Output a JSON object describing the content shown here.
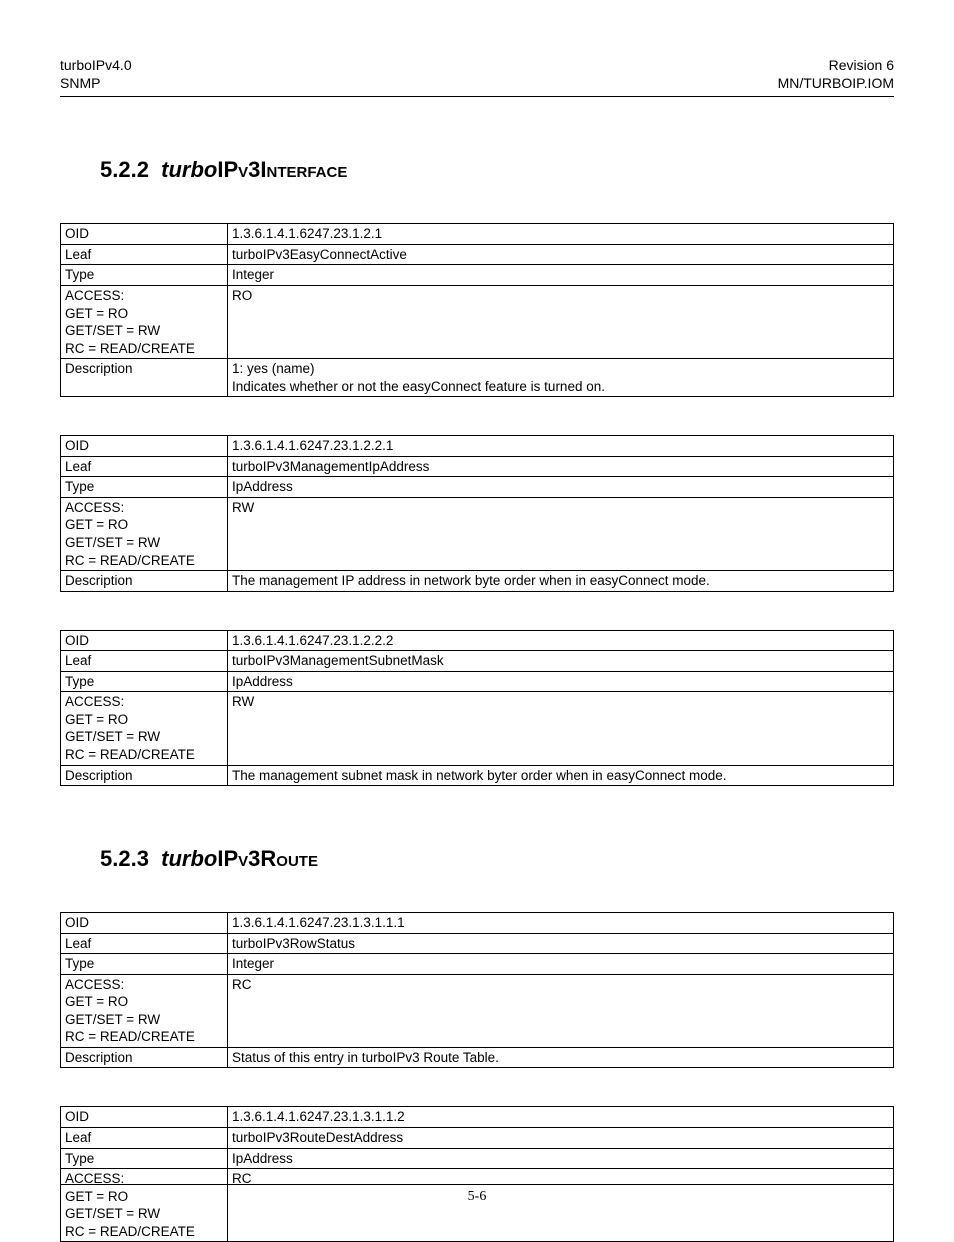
{
  "header": {
    "left_line1": "turboIPv4.0",
    "left_line2": "SNMP",
    "right_line1": "Revision 6",
    "right_line2": "MN/TURBOIP.IOM"
  },
  "sections": [
    {
      "number": "5.2.2",
      "title_prefix": "turbo",
      "title_rest": "IPv3Interface",
      "tables": [
        {
          "oid": "1.3.6.1.4.1.6247.23.1.2.1",
          "leaf": "turboIPv3EasyConnectActive",
          "type": "Integer",
          "access": "RO",
          "description": "1: yes (name)\nIndicates whether or not the easyConnect feature is turned on."
        },
        {
          "oid": "1.3.6.1.4.1.6247.23.1.2.2.1",
          "leaf": "turboIPv3ManagementIpAddress",
          "type": "IpAddress",
          "access": "RW",
          "description": "The management IP address in network byte order when in easyConnect mode."
        },
        {
          "oid": "1.3.6.1.4.1.6247.23.1.2.2.2",
          "leaf": "turboIPv3ManagementSubnetMask",
          "type": "IpAddress",
          "access": "RW",
          "description": "The management subnet mask in network byter order when in easyConnect mode."
        }
      ]
    },
    {
      "number": "5.2.3",
      "title_prefix": "turbo",
      "title_rest": "IPv3Route",
      "tables": [
        {
          "oid": "1.3.6.1.4.1.6247.23.1.3.1.1.1",
          "leaf": "turboIPv3RowStatus",
          "type": "Integer",
          "access": "RC",
          "description": "Status of this entry in turboIPv3 Route Table."
        },
        {
          "oid": "1.3.6.1.4.1.6247.23.1.3.1.1.2",
          "leaf": "turboIPv3RouteDestAddress",
          "type": "IpAddress",
          "access": "RC",
          "description": null
        }
      ]
    }
  ],
  "row_labels": {
    "oid": "OID",
    "leaf": "Leaf",
    "type": "Type",
    "access": "ACCESS:\nGET = RO\nGET/SET = RW\nRC = READ/CREATE",
    "description": "Description"
  },
  "footer": {
    "page_number": "5-6"
  }
}
